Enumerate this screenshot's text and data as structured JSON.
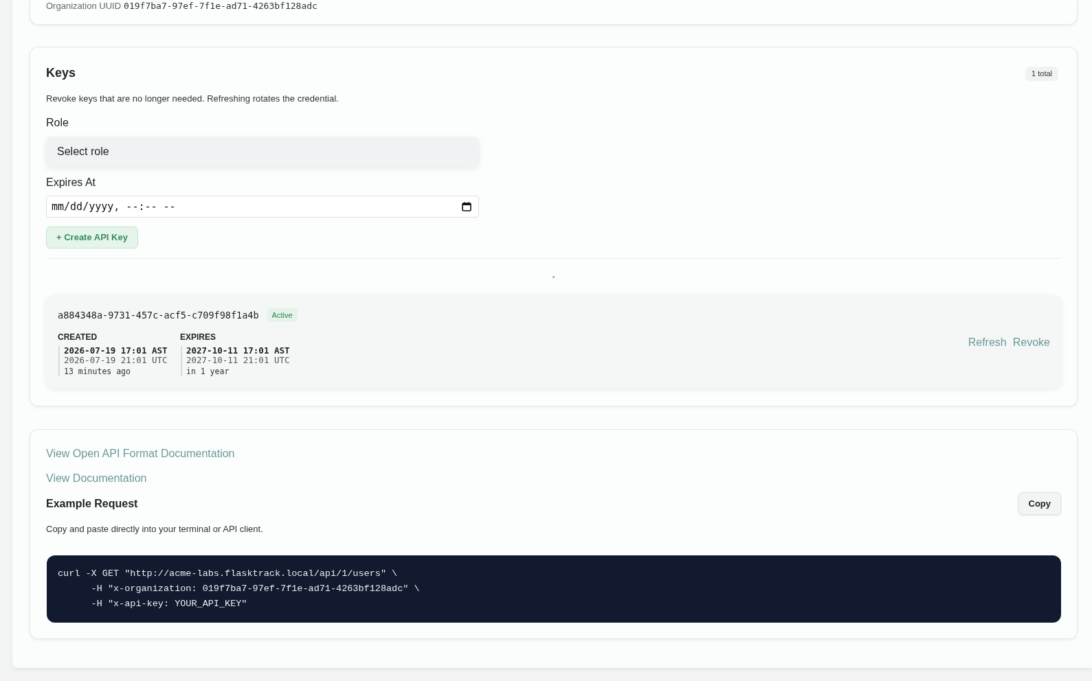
{
  "organization": {
    "label": "Organization UUID",
    "value": "019f7ba7-97ef-7f1e-ad71-4263bf128adc"
  },
  "keys_panel": {
    "title": "Keys",
    "count_badge": "1 total",
    "description": "Revoke keys that are no longer needed. Refreshing rotates the credential.",
    "form": {
      "role": {
        "label": "Role",
        "placeholder": "Select role"
      },
      "expires_at": {
        "label": "Expires At",
        "placeholder": "mm/dd/yyyy, --:-- --"
      },
      "create_button": "+ Create API Key"
    },
    "keys": [
      {
        "id": "a884348a-9731-457c-acf5-c709f98f1a4b",
        "status": "Active",
        "dates": [
          {
            "label": "CREATED",
            "local": "2026-07-19 17:01 AST",
            "utc": "2026-07-19 21:01 UTC",
            "relative": "13 minutes ago"
          },
          {
            "label": "EXPIRES",
            "local": "2027-10-11 17:01 AST",
            "utc": "2027-10-11 21:01 UTC",
            "relative": "in 1 year"
          }
        ],
        "actions": [
          "Refresh",
          "Revoke"
        ]
      }
    ]
  },
  "docs": {
    "links": [
      "View Open API Format Documentation",
      "View Documentation"
    ],
    "example": {
      "title": "Example Request",
      "copy_button": "Copy",
      "description": "Copy and paste directly into your terminal or API client.",
      "code": [
        "curl -X GET \"http://acme-labs.flasktrack.local/api/1/users\" \\",
        "      -H \"x-organization: 019f7ba7-97ef-7f1e-ad71-4263bf128adc\" \\",
        "      -H \"x-api-key: YOUR_API_KEY\""
      ]
    }
  }
}
